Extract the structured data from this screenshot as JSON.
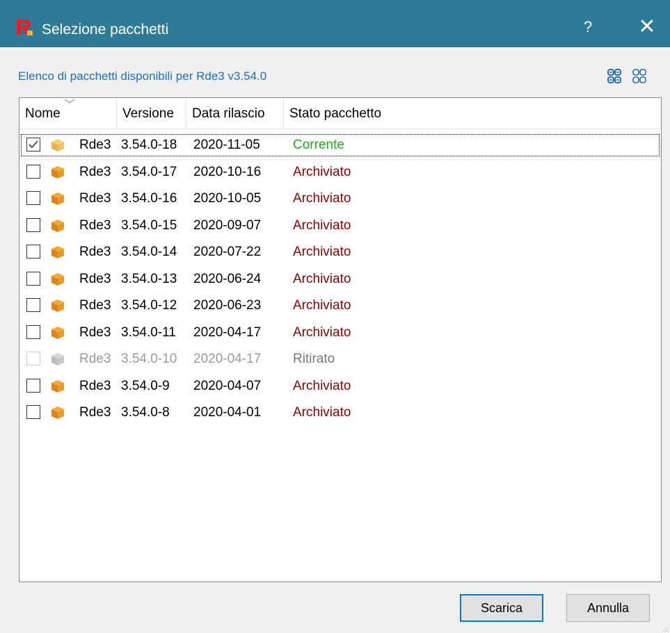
{
  "window": {
    "title": "Selezione pacchetti",
    "help_label": "?",
    "close_label": "✕",
    "title_bar_color": "#2f7a96"
  },
  "subtitle": "Elenco di pacchetti disponibili per Rde3 v3.54.0",
  "columns": {
    "name": "Nome",
    "version": "Versione",
    "release_date": "Data rilascio",
    "status": "Stato pacchetto"
  },
  "rows": [
    {
      "name": "Rde3",
      "version": "3.54.0-18",
      "date": "2020-11-05",
      "status": "Corrente",
      "checked": true,
      "enabled": true,
      "status_type": "current"
    },
    {
      "name": "Rde3",
      "version": "3.54.0-17",
      "date": "2020-10-16",
      "status": "Archiviato",
      "checked": false,
      "enabled": true,
      "status_type": "archived"
    },
    {
      "name": "Rde3",
      "version": "3.54.0-16",
      "date": "2020-10-05",
      "status": "Archiviato",
      "checked": false,
      "enabled": true,
      "status_type": "archived"
    },
    {
      "name": "Rde3",
      "version": "3.54.0-15",
      "date": "2020-09-07",
      "status": "Archiviato",
      "checked": false,
      "enabled": true,
      "status_type": "archived"
    },
    {
      "name": "Rde3",
      "version": "3.54.0-14",
      "date": "2020-07-22",
      "status": "Archiviato",
      "checked": false,
      "enabled": true,
      "status_type": "archived"
    },
    {
      "name": "Rde3",
      "version": "3.54.0-13",
      "date": "2020-06-24",
      "status": "Archiviato",
      "checked": false,
      "enabled": true,
      "status_type": "archived"
    },
    {
      "name": "Rde3",
      "version": "3.54.0-12",
      "date": "2020-06-23",
      "status": "Archiviato",
      "checked": false,
      "enabled": true,
      "status_type": "archived"
    },
    {
      "name": "Rde3",
      "version": "3.54.0-11",
      "date": "2020-04-17",
      "status": "Archiviato",
      "checked": false,
      "enabled": true,
      "status_type": "archived"
    },
    {
      "name": "Rde3",
      "version": "3.54.0-10",
      "date": "2020-04-17",
      "status": "Ritirato",
      "checked": false,
      "enabled": false,
      "status_type": "retired"
    },
    {
      "name": "Rde3",
      "version": "3.54.0-9",
      "date": "2020-04-07",
      "status": "Archiviato",
      "checked": false,
      "enabled": true,
      "status_type": "archived"
    },
    {
      "name": "Rde3",
      "version": "3.54.0-8",
      "date": "2020-04-01",
      "status": "Archiviato",
      "checked": false,
      "enabled": true,
      "status_type": "archived"
    }
  ],
  "buttons": {
    "download": "Scarica",
    "cancel": "Annulla"
  },
  "icons": {
    "app": "app-r-logo-icon",
    "package": "package-box-icon",
    "expand_all": "expand-all-icon",
    "collapse_all": "collapse-all-icon"
  },
  "colors": {
    "accent": "#0078d7",
    "status_current": "#22a822",
    "status_archived": "#8b0000",
    "status_retired": "#777777",
    "link_text": "#1e6fb8"
  }
}
